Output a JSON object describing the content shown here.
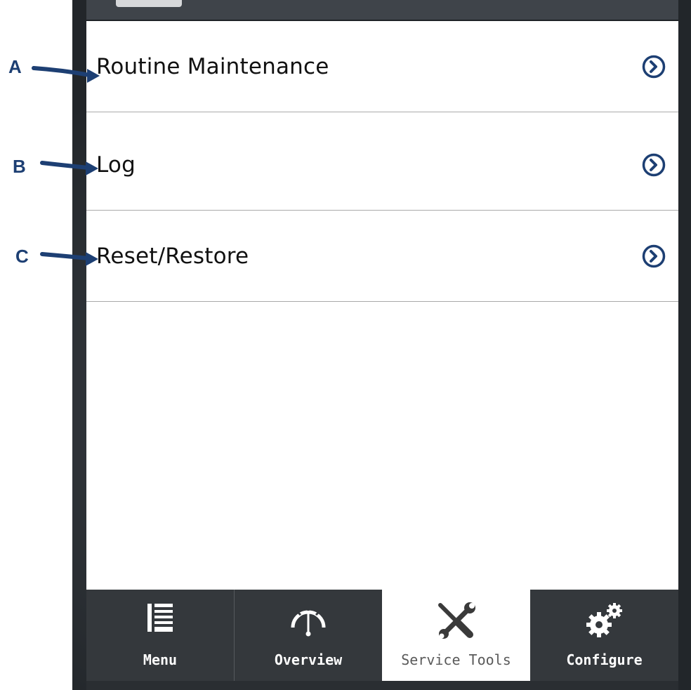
{
  "menu": {
    "items": [
      {
        "label": "Routine Maintenance",
        "annotation": "A",
        "icon": "chevron-right-circle-icon"
      },
      {
        "label": "Log",
        "annotation": "B",
        "icon": "chevron-right-circle-icon"
      },
      {
        "label": "Reset/Restore",
        "annotation": "C",
        "icon": "chevron-right-circle-icon"
      }
    ]
  },
  "nav": {
    "items": [
      {
        "label": "Menu",
        "icon": "list-menu-icon",
        "active": false
      },
      {
        "label": "Overview",
        "icon": "gauge-icon",
        "active": false
      },
      {
        "label": "Service Tools",
        "icon": "wrench-screwdriver-icon",
        "active": true
      },
      {
        "label": "Configure",
        "icon": "gears-icon",
        "active": false
      }
    ]
  },
  "colors": {
    "accent_chevron": "#1d3f73",
    "annotation": "#1d3f73",
    "nav_background": "#34383c",
    "nav_active_background": "#ffffff",
    "divider": "#a9a9a9"
  }
}
